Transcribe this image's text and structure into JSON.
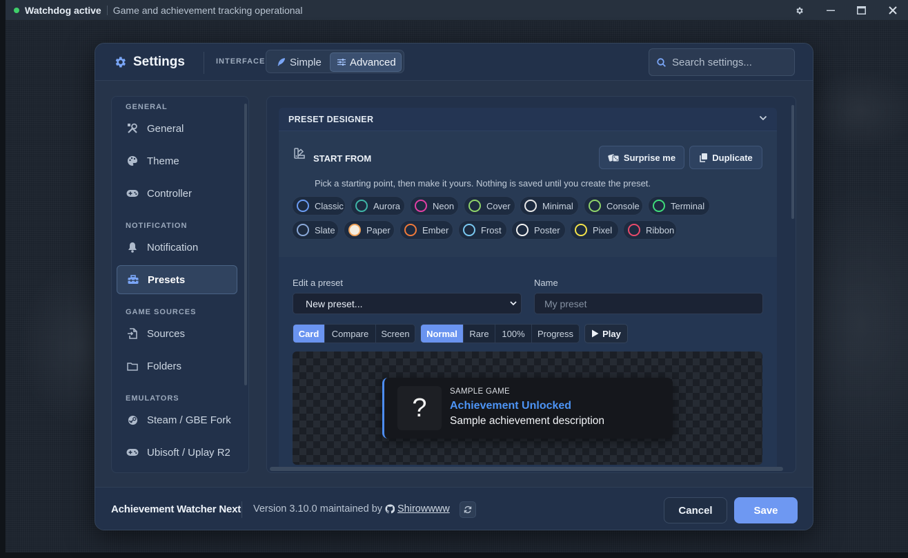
{
  "titlebar": {
    "status_title": "Watchdog active",
    "status_text": "Game and achievement tracking operational",
    "status_color": "#3fcf6a"
  },
  "header": {
    "title": "Settings",
    "interface_label": "INTERFACE",
    "mode_simple": "Simple",
    "mode_advanced": "Advanced",
    "active_mode": "Advanced",
    "search_placeholder": "Search settings..."
  },
  "sidebar": {
    "sections": {
      "general": "GENERAL",
      "notification": "NOTIFICATION",
      "game_sources": "GAME SOURCES",
      "emulators": "EMULATORS"
    },
    "items": [
      {
        "label": "General",
        "icon": "tools-icon"
      },
      {
        "label": "Theme",
        "icon": "palette-icon"
      },
      {
        "label": "Controller",
        "icon": "gamepad-icon"
      },
      {
        "label": "Notification",
        "icon": "bell-icon"
      },
      {
        "label": "Presets",
        "icon": "toolbox-icon",
        "active": true
      },
      {
        "label": "Sources",
        "icon": "file-import-icon"
      },
      {
        "label": "Folders",
        "icon": "folder-icon"
      },
      {
        "label": "Steam / GBE Fork",
        "icon": "steam-icon"
      },
      {
        "label": "Ubisoft / Uplay R2",
        "icon": "gamepad-icon"
      }
    ]
  },
  "preset_designer": {
    "title": "PRESET DESIGNER",
    "start_from": {
      "title": "START FROM",
      "description": "Pick a starting point, then make it yours. Nothing is saved until you create the preset.",
      "surprise_label": "Surprise me",
      "duplicate_label": "Duplicate"
    },
    "presets": [
      {
        "label": "Classic",
        "color": "#6a9bf2"
      },
      {
        "label": "Aurora",
        "color": "#3fb6a8"
      },
      {
        "label": "Neon",
        "color": "#e23fa5"
      },
      {
        "label": "Cover",
        "color": "#8fd46a"
      },
      {
        "label": "Minimal",
        "color": "#e8e8e8"
      },
      {
        "label": "Console",
        "color": "#8fd46a"
      },
      {
        "label": "Terminal",
        "color": "#3fdc7a"
      },
      {
        "label": "Slate",
        "color": "#8aa8d8"
      },
      {
        "label": "Paper",
        "color": "#f0a35a",
        "fill": "#f4ede0"
      },
      {
        "label": "Ember",
        "color": "#f07a3a"
      },
      {
        "label": "Frost",
        "color": "#7ac8f0"
      },
      {
        "label": "Poster",
        "color": "#f2f2f2"
      },
      {
        "label": "Pixel",
        "color": "#f2e24a"
      },
      {
        "label": "Ribbon",
        "color": "#e84a6a"
      }
    ],
    "edit_label": "Edit a preset",
    "edit_value": "New preset...",
    "name_label": "Name",
    "name_placeholder": "My preset",
    "view_tabs": [
      "Card",
      "Compare",
      "Screen"
    ],
    "active_view": "Card",
    "variant_tabs": [
      "Normal",
      "Rare",
      "100%",
      "Progress"
    ],
    "active_variant": "Normal",
    "play_label": "Play",
    "preview": {
      "art_glyph": "?",
      "game": "SAMPLE GAME",
      "title": "Achievement Unlocked",
      "description": "Sample achievement description",
      "accent": "#4d8df2"
    }
  },
  "footer": {
    "app_name": "Achievement Watcher Next",
    "version_text": "Version 3.10.0 maintained by",
    "author": "Shirowwww",
    "cancel_label": "Cancel",
    "save_label": "Save"
  }
}
